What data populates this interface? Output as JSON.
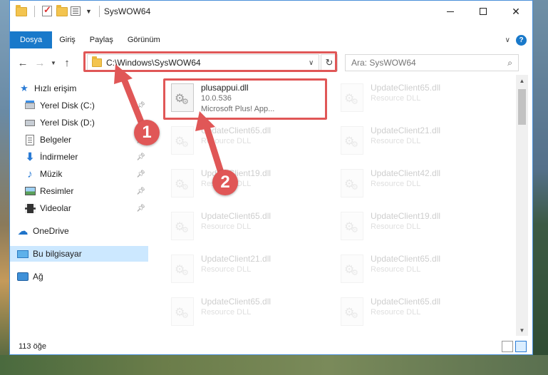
{
  "window": {
    "title": "SysWOW64"
  },
  "ribbon": {
    "tabs": [
      {
        "label": "Dosya"
      },
      {
        "label": "Giriş"
      },
      {
        "label": "Paylaş"
      },
      {
        "label": "Görünüm"
      }
    ]
  },
  "navigation": {
    "address": "C:\\Windows\\SysWOW64",
    "search_placeholder": "Ara: SysWOW64"
  },
  "sidebar": {
    "items": [
      {
        "label": "Hızlı erişim",
        "icon": "star-icon"
      },
      {
        "label": "Yerel Disk (C:)",
        "icon": "drive-icon",
        "pinned": true
      },
      {
        "label": "Yerel Disk (D:)",
        "icon": "drive-icon",
        "pinned": false
      },
      {
        "label": "Belgeler",
        "icon": "document-icon",
        "pinned": true
      },
      {
        "label": "İndirmeler",
        "icon": "download-icon",
        "pinned": true
      },
      {
        "label": "Müzik",
        "icon": "music-icon",
        "pinned": true
      },
      {
        "label": "Resimler",
        "icon": "pictures-icon",
        "pinned": true
      },
      {
        "label": "Videolar",
        "icon": "video-icon",
        "pinned": true
      },
      {
        "label": "OneDrive",
        "icon": "cloud-icon"
      },
      {
        "label": "Bu bilgisayar",
        "icon": "computer-icon",
        "selected": true
      },
      {
        "label": "Ağ",
        "icon": "network-icon"
      }
    ]
  },
  "files": {
    "highlighted": {
      "name": "plusappui.dll",
      "version": "10.0.536",
      "description": "Microsoft Plus! App..."
    },
    "items": [
      {
        "name": "UpdateClient65.dll",
        "type": "Resource DLL"
      },
      {
        "name": "UpdateClient65.dll",
        "type": "Resource DLL"
      },
      {
        "name": "UpdateClient21.dll",
        "type": "Resource DLL"
      },
      {
        "name": "UpdateClient19.dll",
        "type": "Resource DLL"
      },
      {
        "name": "UpdateClient42.dll",
        "type": "Resource DLL"
      },
      {
        "name": "UpdateClient65.dll",
        "type": "Resource DLL"
      },
      {
        "name": "UpdateClient19.dll",
        "type": "Resource DLL"
      },
      {
        "name": "UpdateClient21.dll",
        "type": "Resource DLL"
      },
      {
        "name": "UpdateClient65.dll",
        "type": "Resource DLL"
      },
      {
        "name": "UpdateClient65.dll",
        "type": "Resource DLL"
      },
      {
        "name": "UpdateClient65.dll",
        "type": "Resource DLL"
      }
    ]
  },
  "status": {
    "count": "113 öğe"
  },
  "annotations": {
    "step1": "1",
    "step2": "2",
    "color": "#e05757"
  }
}
